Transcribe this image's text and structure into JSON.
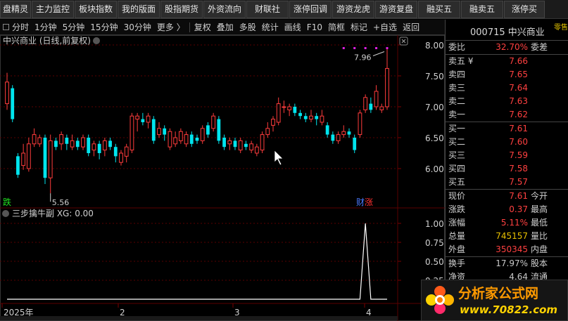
{
  "top_buttons": [
    {
      "label": "盘精灵",
      "w": 44
    },
    {
      "label": "主力监控",
      "w": 60
    },
    {
      "label": "板块指数",
      "w": 60
    },
    {
      "label": "我的版面",
      "w": 60
    },
    {
      "label": "股指期货",
      "w": 60
    },
    {
      "label": "外资流向",
      "w": 60
    },
    {
      "label": "财联社",
      "w": 60
    },
    {
      "label": "涨停回调",
      "w": 60
    },
    {
      "label": "游资龙虎",
      "w": 60
    },
    {
      "label": "游资复盘",
      "w": 60
    },
    {
      "label": "融买五",
      "w": 60
    },
    {
      "label": "融卖五",
      "w": 60
    },
    {
      "label": "涨停买",
      "w": 58
    }
  ],
  "toolbar": {
    "periods": [
      "分时",
      "1分钟",
      "5分钟",
      "15分钟",
      "30分钟"
    ],
    "more": "更多",
    "more_arrow": "〉",
    "tools": [
      "复权",
      "叠加",
      "多股",
      "统计",
      "画线",
      "F10",
      "简框",
      "标记"
    ],
    "add_self": "+自选",
    "back": "返回"
  },
  "chart": {
    "header": "中兴商业 (日线,前复权)",
    "high_label": "7.96",
    "low_label": "5.56",
    "die_tag": "跌",
    "cai_tag": "财",
    "zhang_tag": "涨",
    "indicator_label": "三步擒牛副  XG: 0.00",
    "date_labels": [
      "2025年",
      "2",
      "3",
      "4"
    ],
    "close_icon": "close-icon",
    "settings_icon": "chevron-down-icon"
  },
  "chart_data": [
    {
      "type": "candlestick",
      "title": "中兴商业 (日线,前复权)",
      "y_ticks": [
        8.0,
        7.5,
        7.0,
        6.5,
        6.0
      ],
      "ylim": [
        5.5,
        8.1
      ],
      "x_labels": [
        "2025年",
        "2",
        "3",
        "4"
      ],
      "candles": [
        {
          "o": 7.05,
          "c": 7.4,
          "h": 7.55,
          "l": 6.95
        },
        {
          "o": 7.3,
          "c": 6.8,
          "h": 7.35,
          "l": 6.75
        },
        {
          "o": 6.2,
          "c": 5.9,
          "h": 6.25,
          "l": 5.85
        },
        {
          "o": 6.05,
          "c": 6.25,
          "h": 6.4,
          "l": 5.98
        },
        {
          "o": 6.0,
          "c": 6.4,
          "h": 6.5,
          "l": 5.95
        },
        {
          "o": 6.4,
          "c": 6.55,
          "h": 6.65,
          "l": 6.35
        },
        {
          "o": 6.4,
          "c": 6.5,
          "h": 6.55,
          "l": 6.35
        },
        {
          "o": 6.5,
          "c": 5.85,
          "h": 6.55,
          "l": 5.75
        },
        {
          "o": 5.85,
          "c": 6.45,
          "h": 6.55,
          "l": 5.6
        },
        {
          "o": 6.45,
          "c": 6.35,
          "h": 6.5,
          "l": 6.3
        },
        {
          "o": 6.4,
          "c": 6.55,
          "h": 6.6,
          "l": 6.3
        },
        {
          "o": 6.5,
          "c": 6.4,
          "h": 6.55,
          "l": 6.3
        },
        {
          "o": 6.35,
          "c": 6.45,
          "h": 6.55,
          "l": 6.3
        },
        {
          "o": 6.45,
          "c": 6.35,
          "h": 6.5,
          "l": 6.3
        },
        {
          "o": 6.35,
          "c": 6.5,
          "h": 6.55,
          "l": 6.3
        },
        {
          "o": 6.5,
          "c": 6.25,
          "h": 6.55,
          "l": 6.2
        },
        {
          "o": 6.3,
          "c": 6.4,
          "h": 6.45,
          "l": 6.2
        },
        {
          "o": 6.4,
          "c": 6.25,
          "h": 6.45,
          "l": 6.15
        },
        {
          "o": 6.3,
          "c": 6.45,
          "h": 6.5,
          "l": 6.2
        },
        {
          "o": 6.45,
          "c": 6.35,
          "h": 6.5,
          "l": 6.3
        },
        {
          "o": 6.35,
          "c": 6.2,
          "h": 6.4,
          "l": 6.1
        },
        {
          "o": 6.1,
          "c": 6.25,
          "h": 6.3,
          "l": 6.05
        },
        {
          "o": 6.2,
          "c": 6.35,
          "h": 6.4,
          "l": 6.1
        },
        {
          "o": 6.3,
          "c": 6.85,
          "h": 6.9,
          "l": 6.25
        },
        {
          "o": 6.8,
          "c": 6.85,
          "h": 6.9,
          "l": 6.6
        },
        {
          "o": 6.8,
          "c": 6.75,
          "h": 6.9,
          "l": 6.7
        },
        {
          "o": 6.75,
          "c": 6.85,
          "h": 6.9,
          "l": 6.65
        },
        {
          "o": 6.8,
          "c": 6.45,
          "h": 6.85,
          "l": 6.4
        },
        {
          "o": 6.55,
          "c": 6.65,
          "h": 6.75,
          "l": 6.5
        },
        {
          "o": 6.65,
          "c": 6.55,
          "h": 6.7,
          "l": 6.45
        },
        {
          "o": 6.35,
          "c": 6.6,
          "h": 6.65,
          "l": 6.3
        },
        {
          "o": 6.4,
          "c": 6.5,
          "h": 6.6,
          "l": 6.35
        },
        {
          "o": 6.45,
          "c": 6.6,
          "h": 6.65,
          "l": 6.4
        },
        {
          "o": 6.4,
          "c": 6.55,
          "h": 6.6,
          "l": 6.35
        },
        {
          "o": 6.55,
          "c": 6.4,
          "h": 6.6,
          "l": 6.35
        },
        {
          "o": 6.5,
          "c": 6.45,
          "h": 6.55,
          "l": 6.4
        },
        {
          "o": 6.45,
          "c": 6.65,
          "h": 6.7,
          "l": 6.4
        },
        {
          "o": 6.7,
          "c": 6.55,
          "h": 6.75,
          "l": 6.5
        },
        {
          "o": 6.65,
          "c": 6.85,
          "h": 6.9,
          "l": 6.6
        },
        {
          "o": 6.8,
          "c": 6.45,
          "h": 6.85,
          "l": 6.4
        },
        {
          "o": 6.5,
          "c": 6.35,
          "h": 6.55,
          "l": 6.3
        },
        {
          "o": 6.4,
          "c": 6.45,
          "h": 6.5,
          "l": 6.3
        },
        {
          "o": 6.45,
          "c": 6.35,
          "h": 6.5,
          "l": 6.3
        },
        {
          "o": 6.3,
          "c": 6.45,
          "h": 6.5,
          "l": 6.25
        },
        {
          "o": 6.4,
          "c": 6.35,
          "h": 6.45,
          "l": 6.3
        },
        {
          "o": 6.3,
          "c": 6.4,
          "h": 6.45,
          "l": 6.25
        },
        {
          "o": 6.25,
          "c": 6.35,
          "h": 6.4,
          "l": 6.2
        },
        {
          "o": 6.3,
          "c": 6.55,
          "h": 6.6,
          "l": 6.25
        },
        {
          "o": 6.55,
          "c": 6.65,
          "h": 6.75,
          "l": 6.5
        },
        {
          "o": 6.7,
          "c": 6.8,
          "h": 6.85,
          "l": 6.6
        },
        {
          "o": 6.75,
          "c": 7.05,
          "h": 7.15,
          "l": 6.7
        },
        {
          "o": 7.0,
          "c": 7.0,
          "h": 7.1,
          "l": 6.9
        },
        {
          "o": 6.95,
          "c": 7.0,
          "h": 7.05,
          "l": 6.85
        },
        {
          "o": 7.0,
          "c": 6.9,
          "h": 7.05,
          "l": 6.85
        },
        {
          "o": 6.9,
          "c": 6.85,
          "h": 6.95,
          "l": 6.8
        },
        {
          "o": 6.85,
          "c": 6.8,
          "h": 6.9,
          "l": 6.75
        },
        {
          "o": 6.8,
          "c": 6.85,
          "h": 6.95,
          "l": 6.75
        },
        {
          "o": 6.85,
          "c": 6.8,
          "h": 6.9,
          "l": 6.7
        },
        {
          "o": 6.75,
          "c": 6.85,
          "h": 6.95,
          "l": 6.7
        },
        {
          "o": 6.7,
          "c": 6.55,
          "h": 6.75,
          "l": 6.5
        },
        {
          "o": 6.55,
          "c": 6.45,
          "h": 6.6,
          "l": 6.4
        },
        {
          "o": 6.45,
          "c": 6.55,
          "h": 6.6,
          "l": 6.4
        },
        {
          "o": 6.55,
          "c": 6.6,
          "h": 6.7,
          "l": 6.5
        },
        {
          "o": 6.6,
          "c": 6.55,
          "h": 6.65,
          "l": 6.5
        },
        {
          "o": 6.5,
          "c": 6.3,
          "h": 6.55,
          "l": 6.25
        },
        {
          "o": 6.55,
          "c": 6.9,
          "h": 6.95,
          "l": 6.5
        },
        {
          "o": 6.95,
          "c": 7.15,
          "h": 7.2,
          "l": 6.9
        },
        {
          "o": 7.05,
          "c": 6.95,
          "h": 7.15,
          "l": 6.9
        },
        {
          "o": 7.0,
          "c": 7.25,
          "h": 7.35,
          "l": 6.95
        },
        {
          "o": 6.95,
          "c": 7.0,
          "h": 7.05,
          "l": 6.9
        },
        {
          "o": 7.0,
          "c": 7.62,
          "h": 7.96,
          "l": 6.95
        }
      ],
      "marker_bar_indices": [
        62,
        64,
        66,
        68,
        70
      ]
    },
    {
      "type": "line",
      "title": "三步擒牛副",
      "y_ticks": [
        1.0,
        0.75,
        0.5,
        0.25
      ],
      "ylim": [
        0,
        1.0
      ],
      "series": [
        {
          "name": "XG",
          "x": [
            0,
            65,
            66,
            67,
            70
          ],
          "y": [
            0,
            0,
            1.0,
            0,
            0
          ]
        }
      ]
    }
  ],
  "right_panel": {
    "code": "000715 中兴商业",
    "corner": "零售",
    "webi": {
      "label": "委比",
      "value": "32.70%",
      "label2": "委差"
    },
    "asks": [
      {
        "label": "卖五 ¥",
        "value": "7.66"
      },
      {
        "label": "卖四",
        "value": "7.65"
      },
      {
        "label": "卖三",
        "value": "7.64"
      },
      {
        "label": "卖二",
        "value": "7.63"
      },
      {
        "label": "卖一",
        "value": "7.62"
      }
    ],
    "bids": [
      {
        "label": "买一",
        "value": "7.61"
      },
      {
        "label": "买二",
        "value": "7.60"
      },
      {
        "label": "买三",
        "value": "7.59"
      },
      {
        "label": "买四",
        "value": "7.58"
      },
      {
        "label": "买五",
        "value": "7.57"
      }
    ],
    "stats": [
      {
        "label": "现价",
        "value": "7.61",
        "label2": "今开",
        "cls": "red"
      },
      {
        "label": "涨跌",
        "value": "0.37",
        "label2": "最高",
        "cls": "red"
      },
      {
        "label": "涨幅",
        "value": "5.11%",
        "label2": "最低",
        "cls": "red"
      },
      {
        "label": "总量",
        "value": "745157",
        "label2": "量比",
        "cls": "yellow"
      },
      {
        "label": "外盘",
        "value": "350345",
        "label2": "内盘",
        "cls": "red"
      }
    ],
    "stats2": [
      {
        "label": "换手",
        "value": "17.97%",
        "label2": "股本",
        "cls": "plain"
      },
      {
        "label": "净资",
        "value": "4.64",
        "label2": "流通",
        "cls": "plain"
      }
    ]
  },
  "watermark": {
    "title": "分析家公式网",
    "url": "www.70822.com"
  },
  "colors": {
    "up": "#ff3c3c",
    "down": "#00e5ee",
    "grid": "#5a0000",
    "marker": "#e020e0"
  }
}
